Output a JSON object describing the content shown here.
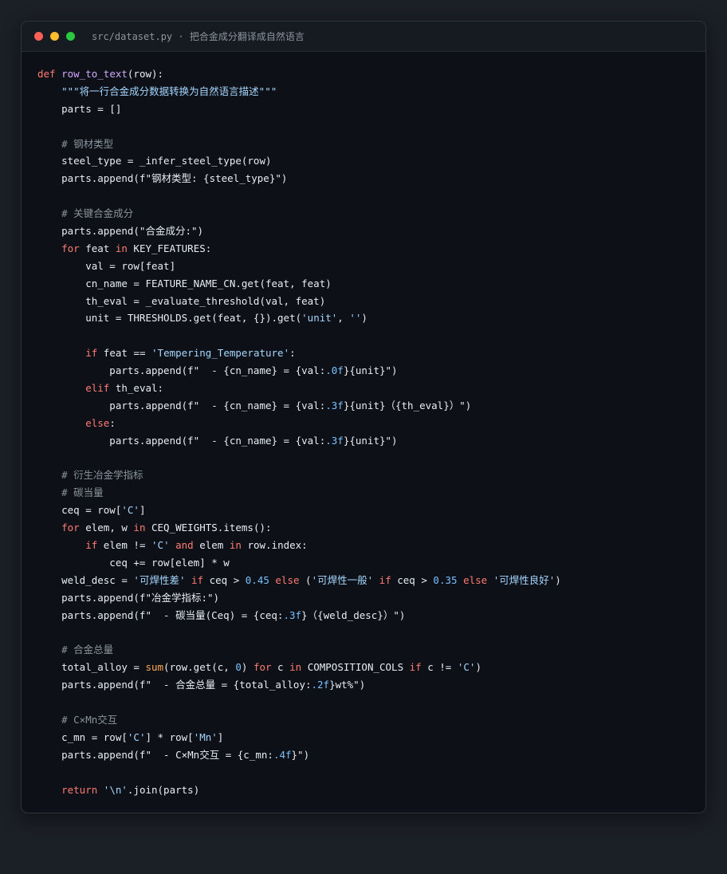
{
  "window": {
    "title": "src/dataset.py · 把合金成分翻译成自然语言"
  },
  "colors": {
    "keyword": "#ff7b72",
    "function": "#d2a8ff",
    "string": "#a5d6ff",
    "number": "#79c0ff",
    "comment": "#8b949e",
    "builtin": "#ffa657",
    "plain": "#e6edf3",
    "background": "#0d1117"
  },
  "code_lines": [
    [
      [
        "kw",
        "def "
      ],
      [
        "fn",
        "row_to_text"
      ],
      [
        "pl",
        "(row):"
      ]
    ],
    [
      [
        "pl",
        "    "
      ],
      [
        "str",
        "\"\"\"将一行合金成分数据转换为自然语言描述\"\"\""
      ]
    ],
    [
      [
        "pl",
        "    parts = []"
      ]
    ],
    [],
    [
      [
        "pl",
        "    "
      ],
      [
        "cm",
        "# 钢材类型"
      ]
    ],
    [
      [
        "pl",
        "    steel_type = _infer_steel_type(row)"
      ]
    ],
    [
      [
        "pl",
        "    parts.append(f\"钢材类型: {steel_type}\")"
      ]
    ],
    [],
    [
      [
        "pl",
        "    "
      ],
      [
        "cm",
        "# 关键合金成分"
      ]
    ],
    [
      [
        "pl",
        "    parts.append(\"合金成分:\")"
      ]
    ],
    [
      [
        "pl",
        "    "
      ],
      [
        "kw",
        "for"
      ],
      [
        "pl",
        " feat "
      ],
      [
        "kw",
        "in"
      ],
      [
        "pl",
        " KEY_FEATURES:"
      ]
    ],
    [
      [
        "pl",
        "        val = row[feat]"
      ]
    ],
    [
      [
        "pl",
        "        cn_name = FEATURE_NAME_CN.get(feat, feat)"
      ]
    ],
    [
      [
        "pl",
        "        th_eval = _evaluate_threshold(val, feat)"
      ]
    ],
    [
      [
        "pl",
        "        unit = THRESHOLDS.get(feat, {}).get("
      ],
      [
        "str",
        "'unit'"
      ],
      [
        "pl",
        ", "
      ],
      [
        "str",
        "''"
      ],
      [
        "pl",
        ")"
      ]
    ],
    [],
    [
      [
        "pl",
        "        "
      ],
      [
        "kw",
        "if"
      ],
      [
        "pl",
        " feat == "
      ],
      [
        "str",
        "'Tempering_Temperature'"
      ],
      [
        "pl",
        ":"
      ]
    ],
    [
      [
        "pl",
        "            parts.append(f\"  - {cn_name} = {val:"
      ],
      [
        "num",
        ".0f"
      ],
      [
        "pl",
        "}{unit}\")"
      ]
    ],
    [
      [
        "pl",
        "        "
      ],
      [
        "kw",
        "elif"
      ],
      [
        "pl",
        " th_eval:"
      ]
    ],
    [
      [
        "pl",
        "            parts.append(f\"  - {cn_name} = {val:"
      ],
      [
        "num",
        ".3f"
      ],
      [
        "pl",
        "}{unit}（{th_eval}）\")"
      ]
    ],
    [
      [
        "pl",
        "        "
      ],
      [
        "kw",
        "else"
      ],
      [
        "pl",
        ":"
      ]
    ],
    [
      [
        "pl",
        "            parts.append(f\"  - {cn_name} = {val:"
      ],
      [
        "num",
        ".3f"
      ],
      [
        "pl",
        "}{unit}\")"
      ]
    ],
    [],
    [
      [
        "pl",
        "    "
      ],
      [
        "cm",
        "# 衍生冶金学指标"
      ]
    ],
    [
      [
        "pl",
        "    "
      ],
      [
        "cm",
        "# 碳当量"
      ]
    ],
    [
      [
        "pl",
        "    ceq = row["
      ],
      [
        "str",
        "'C'"
      ],
      [
        "pl",
        "]"
      ]
    ],
    [
      [
        "pl",
        "    "
      ],
      [
        "kw",
        "for"
      ],
      [
        "pl",
        " elem, w "
      ],
      [
        "kw",
        "in"
      ],
      [
        "pl",
        " CEQ_WEIGHTS.items():"
      ]
    ],
    [
      [
        "pl",
        "        "
      ],
      [
        "kw",
        "if"
      ],
      [
        "pl",
        " elem != "
      ],
      [
        "str",
        "'C'"
      ],
      [
        "pl",
        " "
      ],
      [
        "kw",
        "and"
      ],
      [
        "pl",
        " elem "
      ],
      [
        "kw",
        "in"
      ],
      [
        "pl",
        " row.index:"
      ]
    ],
    [
      [
        "pl",
        "            ceq += row[elem] * w"
      ]
    ],
    [
      [
        "pl",
        "    weld_desc = "
      ],
      [
        "str",
        "'可焊性差'"
      ],
      [
        "pl",
        " "
      ],
      [
        "kw",
        "if"
      ],
      [
        "pl",
        " ceq > "
      ],
      [
        "num",
        "0.45"
      ],
      [
        "pl",
        " "
      ],
      [
        "kw",
        "else"
      ],
      [
        "pl",
        " ("
      ],
      [
        "str",
        "'可焊性一般'"
      ],
      [
        "pl",
        " "
      ],
      [
        "kw",
        "if"
      ],
      [
        "pl",
        " ceq > "
      ],
      [
        "num",
        "0.35"
      ],
      [
        "pl",
        " "
      ],
      [
        "kw",
        "else"
      ],
      [
        "pl",
        " "
      ],
      [
        "str",
        "'可焊性良好'"
      ],
      [
        "pl",
        ")"
      ]
    ],
    [
      [
        "pl",
        "    parts.append(f\"冶金学指标:\")"
      ]
    ],
    [
      [
        "pl",
        "    parts.append(f\"  - 碳当量(Ceq) = {ceq:"
      ],
      [
        "num",
        ".3f"
      ],
      [
        "pl",
        "}（{weld_desc}）\")"
      ]
    ],
    [],
    [
      [
        "pl",
        "    "
      ],
      [
        "cm",
        "# 合金总量"
      ]
    ],
    [
      [
        "pl",
        "    total_alloy = "
      ],
      [
        "bi",
        "sum"
      ],
      [
        "pl",
        "(row.get(c, "
      ],
      [
        "num",
        "0"
      ],
      [
        "pl",
        ") "
      ],
      [
        "kw",
        "for"
      ],
      [
        "pl",
        " c "
      ],
      [
        "kw",
        "in"
      ],
      [
        "pl",
        " COMPOSITION_COLS "
      ],
      [
        "kw",
        "if"
      ],
      [
        "pl",
        " c != "
      ],
      [
        "str",
        "'C'"
      ],
      [
        "pl",
        ")"
      ]
    ],
    [
      [
        "pl",
        "    parts.append(f\"  - 合金总量 = {total_alloy:"
      ],
      [
        "num",
        ".2f"
      ],
      [
        "pl",
        "}wt%\")"
      ]
    ],
    [],
    [
      [
        "pl",
        "    "
      ],
      [
        "cm",
        "# C×Mn交互"
      ]
    ],
    [
      [
        "pl",
        "    c_mn = row["
      ],
      [
        "str",
        "'C'"
      ],
      [
        "pl",
        "] * row["
      ],
      [
        "str",
        "'Mn'"
      ],
      [
        "pl",
        "]"
      ]
    ],
    [
      [
        "pl",
        "    parts.append(f\"  - C×Mn交互 = {c_mn:"
      ],
      [
        "num",
        ".4f"
      ],
      [
        "pl",
        "}\")"
      ]
    ],
    [],
    [
      [
        "pl",
        "    "
      ],
      [
        "kw",
        "return"
      ],
      [
        "pl",
        " "
      ],
      [
        "str",
        "'\\n'"
      ],
      [
        "pl",
        ".join(parts)"
      ]
    ]
  ]
}
